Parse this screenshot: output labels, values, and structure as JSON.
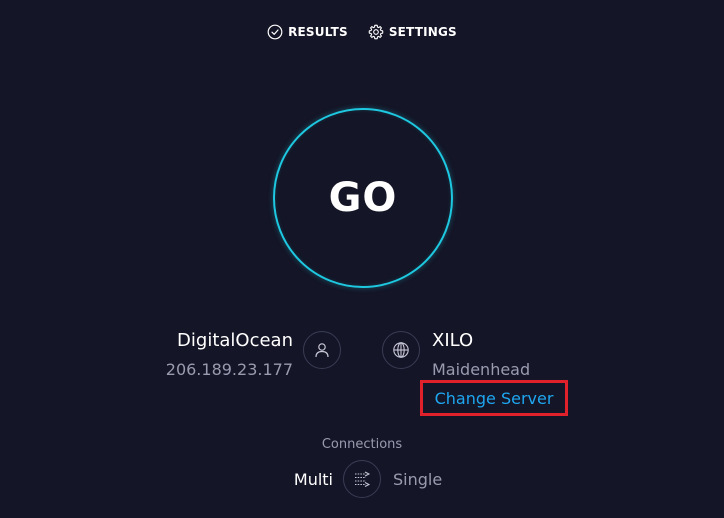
{
  "nav": {
    "results": {
      "label": "RESULTS",
      "icon": "check-circle-icon"
    },
    "settings": {
      "label": "SETTINGS",
      "icon": "gear-icon"
    }
  },
  "go_button": {
    "label": "GO",
    "ring_color": "#1ec8e0"
  },
  "isp": {
    "name": "DigitalOcean",
    "ip": "206.189.23.177",
    "icon": "user-icon"
  },
  "server": {
    "name": "XILO",
    "location": "Maidenhead",
    "icon": "globe-icon",
    "change_label": "Change Server",
    "highlight_color": "#e0202a"
  },
  "connections": {
    "title": "Connections",
    "multi_label": "Multi",
    "single_label": "Single",
    "selected": "Multi",
    "icon": "connections-toggle-icon"
  },
  "colors": {
    "background": "#141526",
    "accent": "#1ec8e0",
    "link": "#1ea6f0",
    "muted_text": "#9b9bb0"
  }
}
